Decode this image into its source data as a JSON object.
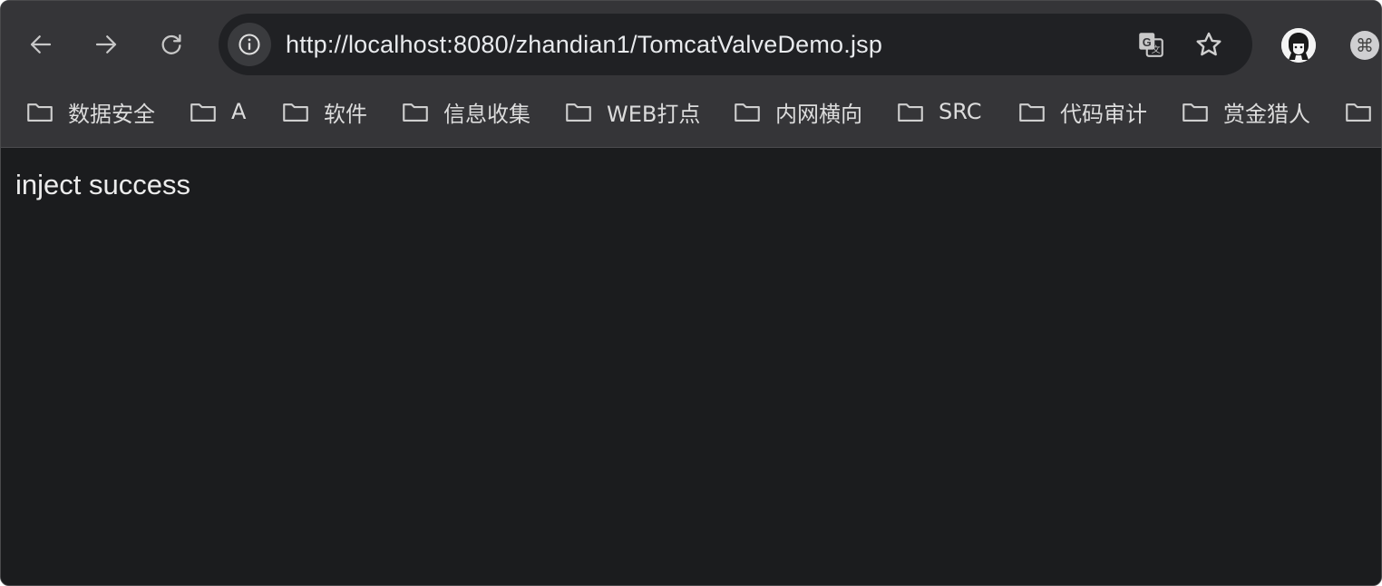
{
  "browser": {
    "url": "http://localhost:8080/zhandian1/TomcatValveDemo.jsp",
    "icons": {
      "back": "arrow-left-icon",
      "forward": "arrow-right-icon",
      "reload": "reload-icon",
      "site_info": "info-icon",
      "translate": "translate-icon",
      "bookmark_star": "star-icon",
      "profile": "avatar",
      "extension": "command-key-icon"
    },
    "extension_glyph": "⌘"
  },
  "bookmarks": [
    {
      "label": "数据安全"
    },
    {
      "label": "A"
    },
    {
      "label": "软件"
    },
    {
      "label": "信息收集"
    },
    {
      "label": "WEB打点"
    },
    {
      "label": "内网横向"
    },
    {
      "label": "SRC"
    },
    {
      "label": "代码审计"
    },
    {
      "label": "赏金猎人"
    },
    {
      "label": ""
    }
  ],
  "page": {
    "body_text": "inject success"
  },
  "colors": {
    "toolbar_bg": "#353538",
    "omnibox_bg": "#202124",
    "content_bg": "#1b1c1e",
    "text": "#e8eaed"
  }
}
